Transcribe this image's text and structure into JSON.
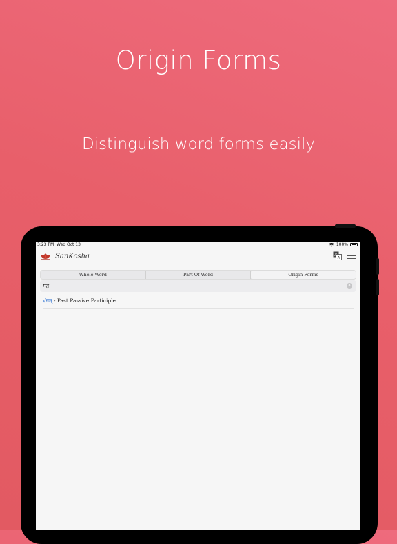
{
  "marketing": {
    "title": "Origin Forms",
    "subtitle": "Distinguish word forms easily"
  },
  "statusbar": {
    "time": "3:23 PM",
    "date": "Wed Oct 13",
    "battery": "100%",
    "icons": [
      "wifi-icon",
      "battery-icon"
    ]
  },
  "navbar": {
    "brand": "SanKosha",
    "icons": [
      "logo-icon",
      "translate-icon",
      "menu-icon"
    ]
  },
  "tabs": [
    {
      "label": "Whole Word",
      "active": false
    },
    {
      "label": "Part Of Word",
      "active": false
    },
    {
      "label": "Origin Forms",
      "active": true
    }
  ],
  "search": {
    "value": "गत"
  },
  "results": [
    {
      "root": "√गम्",
      "separator": " - ",
      "form": "Past Passive Participle"
    }
  ],
  "colors": {
    "background": "#e85f6a",
    "accent_link": "#2a6fd0"
  }
}
